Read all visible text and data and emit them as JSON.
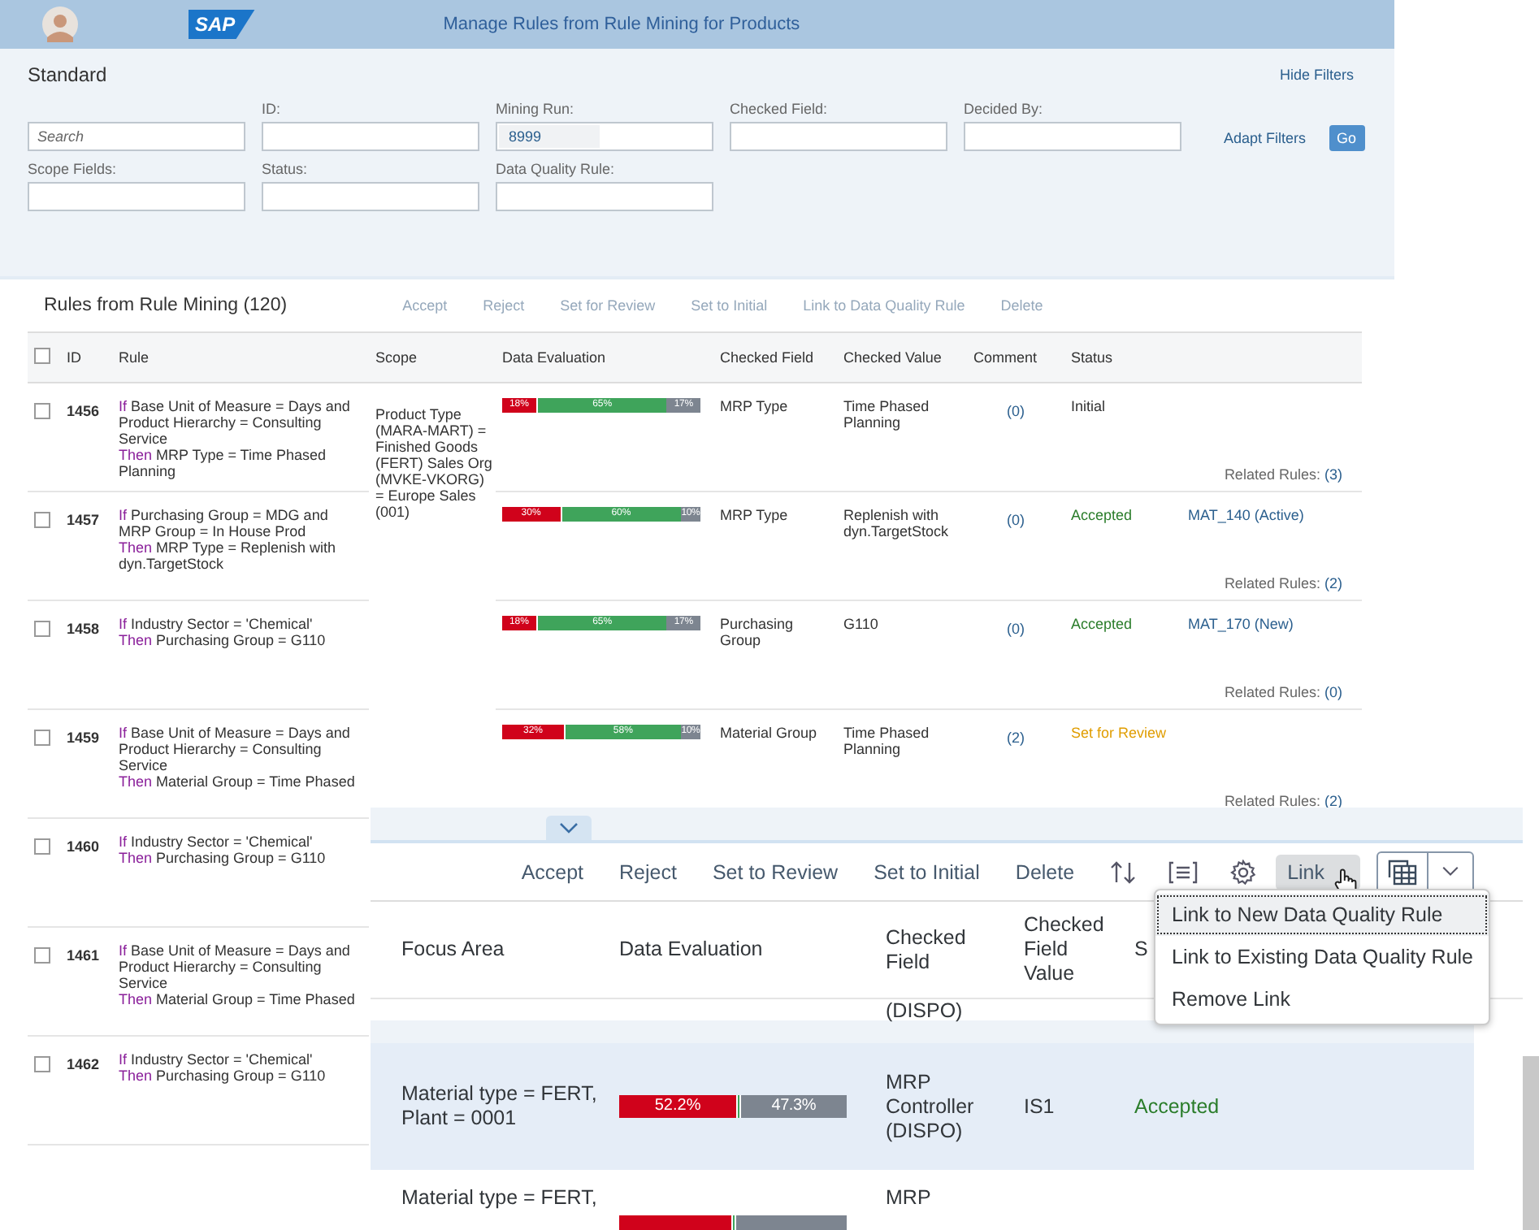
{
  "shell": {
    "logo": "SAP",
    "title": "Manage Rules from Rule Mining for Products"
  },
  "filter_bar": {
    "variant": "Standard",
    "hide_filters": "Hide Filters",
    "adapt_filters": "Adapt Filters",
    "go": "Go",
    "fields": [
      {
        "placeholder": "Search"
      },
      {
        "label": "ID:"
      },
      {
        "label": "Mining Run:",
        "value": "8999"
      },
      {
        "label": "Checked Field:"
      },
      {
        "label": "Decided By:"
      },
      {
        "label": "Scope Fields:"
      },
      {
        "label": "Status:"
      },
      {
        "label": "Data Quality Rule:"
      }
    ]
  },
  "table": {
    "title": "Rules from Rule Mining (120)",
    "actions": [
      {
        "label": "Accept",
        "disabled": true
      },
      {
        "label": "Reject",
        "disabled": true
      },
      {
        "label": "Set for Review",
        "disabled": true
      },
      {
        "label": "Set to Initial",
        "disabled": true
      },
      {
        "label": "Link to Data Quality Rule",
        "disabled": true
      },
      {
        "label": "Delete",
        "disabled": true
      }
    ],
    "select_all": {
      "checked": false
    },
    "columns": [
      "ID",
      "Rule",
      "Scope",
      "Data Evaluation",
      "Checked Field",
      "Checked Value",
      "Comment",
      "Status"
    ],
    "scope": "Product Type (MARA-MART) = Finished Goods (FERT) Sales Org (MVKE-VKORG) = Europe Sales (001)",
    "rows": [
      {
        "checked": false,
        "id": "1456",
        "rule": [
          {
            "keyword": "If",
            "text": "Base Unit of Measure = Days and Product Hierarchy = Consulting Service"
          },
          {
            "keyword": "Then",
            "text": "MRP Type = Time Phased Planning"
          }
        ],
        "evaluation": {
          "left": {
            "text": "18%",
            "level": 0.18
          },
          "middle": {
            "text": "65%"
          },
          "right": {
            "text": "17%",
            "level": 0.17
          }
        },
        "checked_field": "MRP Type",
        "checked_value": "Time Phased Planning",
        "comment": "(0)",
        "status": {
          "text": "Initial",
          "color": "#333333"
        },
        "related_label": "Related Rules:",
        "related_count": "(3)"
      },
      {
        "checked": false,
        "id": "1457",
        "rule": [
          {
            "keyword": "If",
            "text": "Purchasing Group = MDG and MRP Group = In House Prod"
          },
          {
            "keyword": "Then",
            "text": "MRP Type = Replenish with dyn.TargetStock"
          }
        ],
        "evaluation": {
          "left": {
            "text": "30%",
            "level": 0.3
          },
          "middle": {
            "text": "60%"
          },
          "right": {
            "text": "10%",
            "level": 0.1
          }
        },
        "checked_field": "MRP Type",
        "checked_value": "Replenish with dyn.TargetStock",
        "comment": "(0)",
        "status": {
          "text": "Accepted",
          "color": "#2b7d2b"
        },
        "link": "MAT_140 (Active)",
        "related_label": "Related Rules:",
        "related_count": "(2)"
      },
      {
        "checked": false,
        "id": "1458",
        "rule": [
          {
            "keyword": "If",
            "text": "Industry Sector = 'Chemical'"
          },
          {
            "keyword": "Then",
            "text": "Purchasing Group = G110"
          }
        ],
        "evaluation": {
          "left": {
            "text": "18%",
            "level": 0.18
          },
          "middle": {
            "text": "65%"
          },
          "right": {
            "text": "17%",
            "level": 0.17
          }
        },
        "checked_field": "Purchasing Group",
        "checked_value": "G110",
        "comment": "(0)",
        "status": {
          "text": "Accepted",
          "color": "#2b7d2b"
        },
        "link": "MAT_170 (New)",
        "related_label": "Related Rules:",
        "related_count": "(0)"
      },
      {
        "checked": false,
        "id": "1459",
        "rule": [
          {
            "keyword": "If",
            "text": "Base Unit of Measure = Days and Product Hierarchy = Consulting Service"
          },
          {
            "keyword": "Then",
            "text": "Material Group = Time Phased"
          }
        ],
        "evaluation": {
          "left": {
            "text": "32%",
            "level": 0.32
          },
          "middle": {
            "text": "58%"
          },
          "right": {
            "text": "10%",
            "level": 0.1
          }
        },
        "checked_field": "Material Group",
        "checked_value": "Time Phased Planning",
        "comment": "(2)",
        "status": {
          "text": "Set for Review",
          "color": "#e09d00"
        },
        "related_label": "Related Rules:",
        "related_count": "(2)"
      },
      {
        "checked": false,
        "id": "1460",
        "rule": [
          {
            "keyword": "If",
            "text": "Industry Sector = 'Chemical'"
          },
          {
            "keyword": "Then",
            "text": "Purchasing Group = G110"
          }
        ]
      },
      {
        "checked": false,
        "id": "1461",
        "rule": [
          {
            "keyword": "If",
            "text": "Base Unit of Measure = Days and Product Hierarchy = Consulting Service"
          },
          {
            "keyword": "Then",
            "text": "Material Group = Time Phased"
          }
        ]
      },
      {
        "checked": false,
        "id": "1462",
        "rule": [
          {
            "keyword": "If",
            "text": "Industry Sector = 'Chemical'"
          },
          {
            "keyword": "Then",
            "text": "Purchasing Group = G110"
          }
        ]
      }
    ]
  },
  "new_table": {
    "toolbar": [
      {
        "label": "Accept"
      },
      {
        "label": "Reject"
      },
      {
        "label": "Set to Review"
      },
      {
        "label": "Set to Initial"
      },
      {
        "label": "Delete"
      }
    ],
    "link_button": {
      "label": "Link",
      "pressed": true
    },
    "menu": [
      {
        "label": "Link to New Data Quality Rule",
        "selected": true
      },
      {
        "label": "Link to Existing Data Quality Rule",
        "selected": false
      },
      {
        "label": "Remove Link",
        "selected": false
      }
    ],
    "columns": [
      "Focus Area",
      "Data Evaluation",
      "Checked Field",
      "Checked Field Value",
      "S"
    ],
    "rows": [
      {
        "selected": false,
        "checked_field": "(DISPO)"
      },
      {
        "selected": true,
        "focus_area": "Material type = FERT, Plant = 0001",
        "evaluation": {
          "left": {
            "text": "52.2%",
            "level": 0.522
          },
          "right": {
            "text": "47.3%",
            "level": 0.473
          }
        },
        "checked_field": "MRP Controller (DISPO)",
        "value": "IS1",
        "status": {
          "text": "Accepted",
          "color": "#2b7d2b"
        }
      },
      {
        "selected": false,
        "focus_area": "Material type = FERT,",
        "checked_field": "MRP"
      }
    ]
  }
}
